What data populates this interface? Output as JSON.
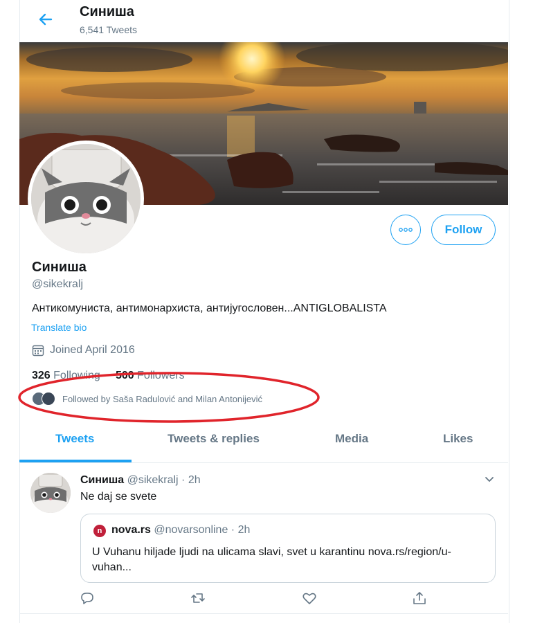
{
  "header": {
    "name": "Синиша",
    "tweet_count": "6,541 Tweets",
    "back_icon": "arrow-left-icon"
  },
  "profile": {
    "name": "Синиша",
    "handle": "@sikekralj",
    "bio": "Антикомуниста, антимонархиста, антијугословен...ANTIGLOBALISTA",
    "translate_label": "Translate bio",
    "joined": "Joined April 2016",
    "following_count": "326",
    "following_label": "Following",
    "followers_count": "500",
    "followers_label": "Followers",
    "followed_by": "Followed by Saša Radulović and Milan Antonijević",
    "follow_label": "Follow",
    "accent_color": "#1da1f2",
    "annotation_color": "#e0242b"
  },
  "tabs": [
    {
      "label": "Tweets",
      "active": true
    },
    {
      "label": "Tweets & replies",
      "active": false
    },
    {
      "label": "Media",
      "active": false
    },
    {
      "label": "Likes",
      "active": false
    }
  ],
  "tweet": {
    "author": "Синиша",
    "handle": "@sikekralj",
    "time": "2h",
    "text": "Ne daj se svete",
    "quote": {
      "logo_letter": "n",
      "author": "nova.rs",
      "handle": "@novarsonline",
      "time": "2h",
      "text": "U Vuhanu hiljade ljudi na ulicama slavi, svet u karantinu nova.rs/region/u-vuhan..."
    },
    "actions": [
      "reply-icon",
      "retweet-icon",
      "like-icon",
      "share-icon"
    ]
  }
}
